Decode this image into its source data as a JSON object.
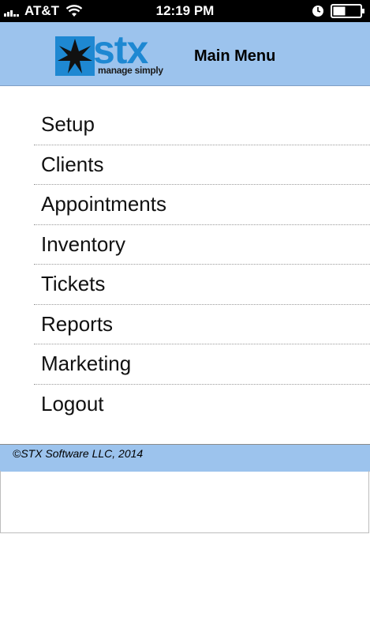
{
  "status_bar": {
    "carrier": "AT&T",
    "time": "12:19 PM",
    "icons": [
      "signal-bars-icon",
      "wifi-icon",
      "clock-icon",
      "battery-icon"
    ]
  },
  "header": {
    "logo_text": "stx",
    "logo_tagline": "manage simply",
    "title": "Main Menu"
  },
  "menu": {
    "items": [
      {
        "label": "Setup"
      },
      {
        "label": "Clients"
      },
      {
        "label": "Appointments"
      },
      {
        "label": "Inventory"
      },
      {
        "label": "Tickets"
      },
      {
        "label": "Reports"
      },
      {
        "label": "Marketing"
      },
      {
        "label": "Logout"
      }
    ]
  },
  "footer": {
    "copyright": "©STX Software LLC, 2014"
  },
  "colors": {
    "header_bg": "#9cc3ed",
    "logo_blue": "#1e88d2",
    "status_bar_bg": "#000000"
  }
}
